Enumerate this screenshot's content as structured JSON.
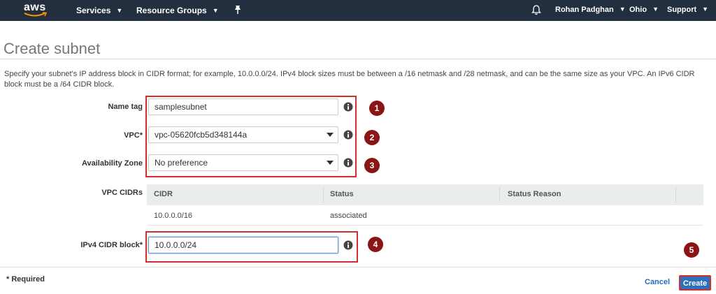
{
  "nav": {
    "logo": "aws",
    "services": "Services",
    "resource_groups": "Resource Groups",
    "user": "Rohan Padghan",
    "region": "Ohio",
    "support": "Support"
  },
  "page": {
    "title": "Create subnet",
    "description": "Specify your subnet's IP address block in CIDR format; for example, 10.0.0.0/24. IPv4 block sizes must be between a /16 netmask and /28 netmask, and can be the same size as your VPC. An IPv6 CIDR block must be a /64 CIDR block."
  },
  "form": {
    "name_tag": {
      "label": "Name tag",
      "value": "samplesubnet"
    },
    "vpc": {
      "label": "VPC*",
      "value": "vpc-05620fcb5d348144a"
    },
    "availability_zone": {
      "label": "Availability Zone",
      "value": "No preference"
    },
    "vpc_cidrs": {
      "label": "VPC CIDRs",
      "columns": [
        "CIDR",
        "Status",
        "Status Reason"
      ],
      "rows": [
        {
          "cidr": "10.0.0.0/16",
          "status": "associated",
          "reason": ""
        }
      ]
    },
    "ipv4_cidr": {
      "label": "IPv4 CIDR block*",
      "value": "10.0.0.0/24"
    }
  },
  "steps": [
    "1",
    "2",
    "3",
    "4",
    "5"
  ],
  "footer": {
    "required": "* Required",
    "cancel": "Cancel",
    "create": "Create"
  },
  "colors": {
    "nav_bg": "#232f3e",
    "annotation_red": "#d32f2f",
    "badge": "#8b1414",
    "primary_button": "#2d6fb9"
  }
}
